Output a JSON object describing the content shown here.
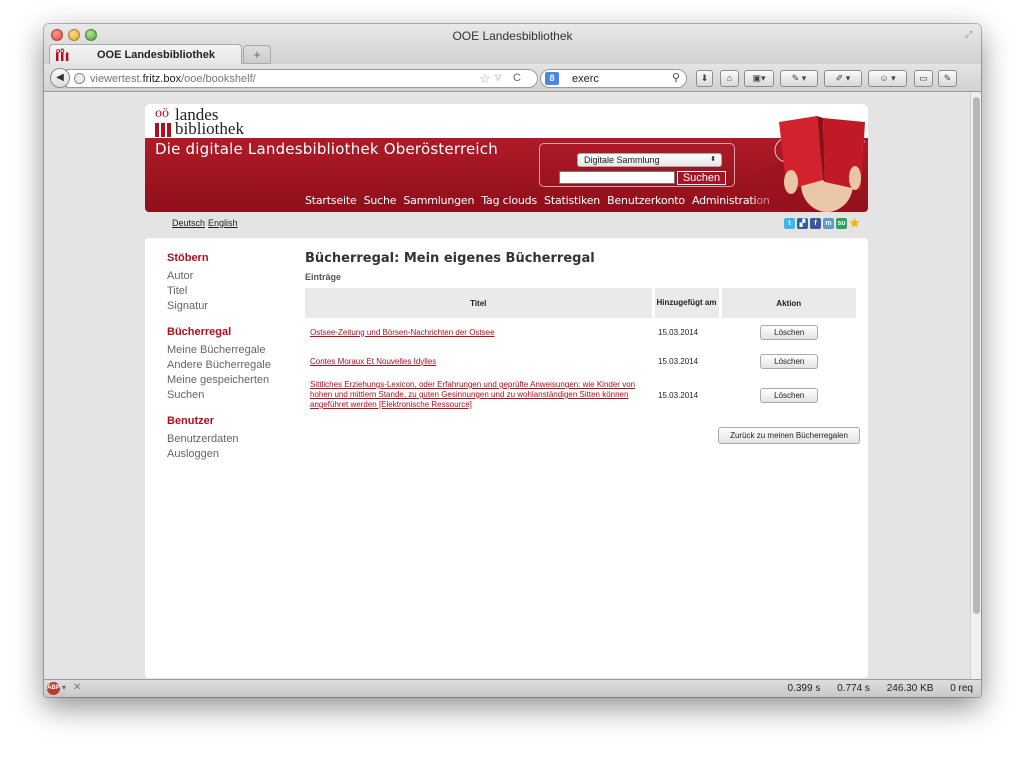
{
  "browser": {
    "window_title": "OOE Landesbibliothek",
    "tab_label": "OOE Landesbibliothek",
    "new_tab_label": "+",
    "url_host_prefix": "viewertest.",
    "url_host": "fritz.box",
    "url_path": "/ooe/bookshelf/",
    "search_text": "exerc",
    "status": {
      "time1": "0.399 s",
      "time2": "0.774 s",
      "size": "246.30 KB",
      "requests": "0 req"
    }
  },
  "site": {
    "logo_oo": "oö",
    "logo_landes": "landes",
    "logo_bibliothek": "bibliothek",
    "banner_title": "Die digitale Landesbibliothek Oberösterreich",
    "search_select": "Digitale Sammlung",
    "search_button": "Suchen",
    "menu": [
      "Startseite",
      "Suche",
      "Sammlungen",
      "Tag clouds",
      "Statistiken",
      "Benutzerkonto",
      "Administration"
    ],
    "languages": [
      "Deutsch",
      "English"
    ]
  },
  "sidebar": {
    "browse_head": "Stöbern",
    "browse_items": [
      "Autor",
      "Titel",
      "Signatur"
    ],
    "shelf_head": "Bücherregal",
    "shelf_items": [
      "Meine Bücherregale",
      "Andere Bücherregale",
      "Meine gespeicherten Suchen"
    ],
    "user_head": "Benutzer",
    "user_items": [
      "Benutzerdaten",
      "Ausloggen"
    ]
  },
  "main": {
    "title": "Bücherregal: Mein eigenes Bücherregal",
    "subtitle": "Einträge",
    "columns": {
      "title": "Titel",
      "added": "Hinzugefügt am",
      "action": "Aktion"
    },
    "rows": [
      {
        "title": "Ostsee-Zeitung und Börsen-Nachrichten der Ostsee",
        "date": "15.03.2014",
        "action": "Löschen"
      },
      {
        "title": "Contes Moraux Et Nouvelles Idylles",
        "date": "15.03.2014",
        "action": "Löschen"
      },
      {
        "title": "Sittliches Erziehungs-Lexicon, oder Erfahrungen und geprüfte Anweisungen: wie Kinder von hohen und mittlern Stande, zu guten Gesinnungen und zu wohlanständigen Sitten können angeführet werden [Elektronische Ressource]",
        "date": "15.03.2014",
        "action": "Löschen"
      }
    ],
    "back_button": "Zurück zu meinen Bücherregalen"
  },
  "colors": {
    "brand_red": "#b10e1e"
  }
}
